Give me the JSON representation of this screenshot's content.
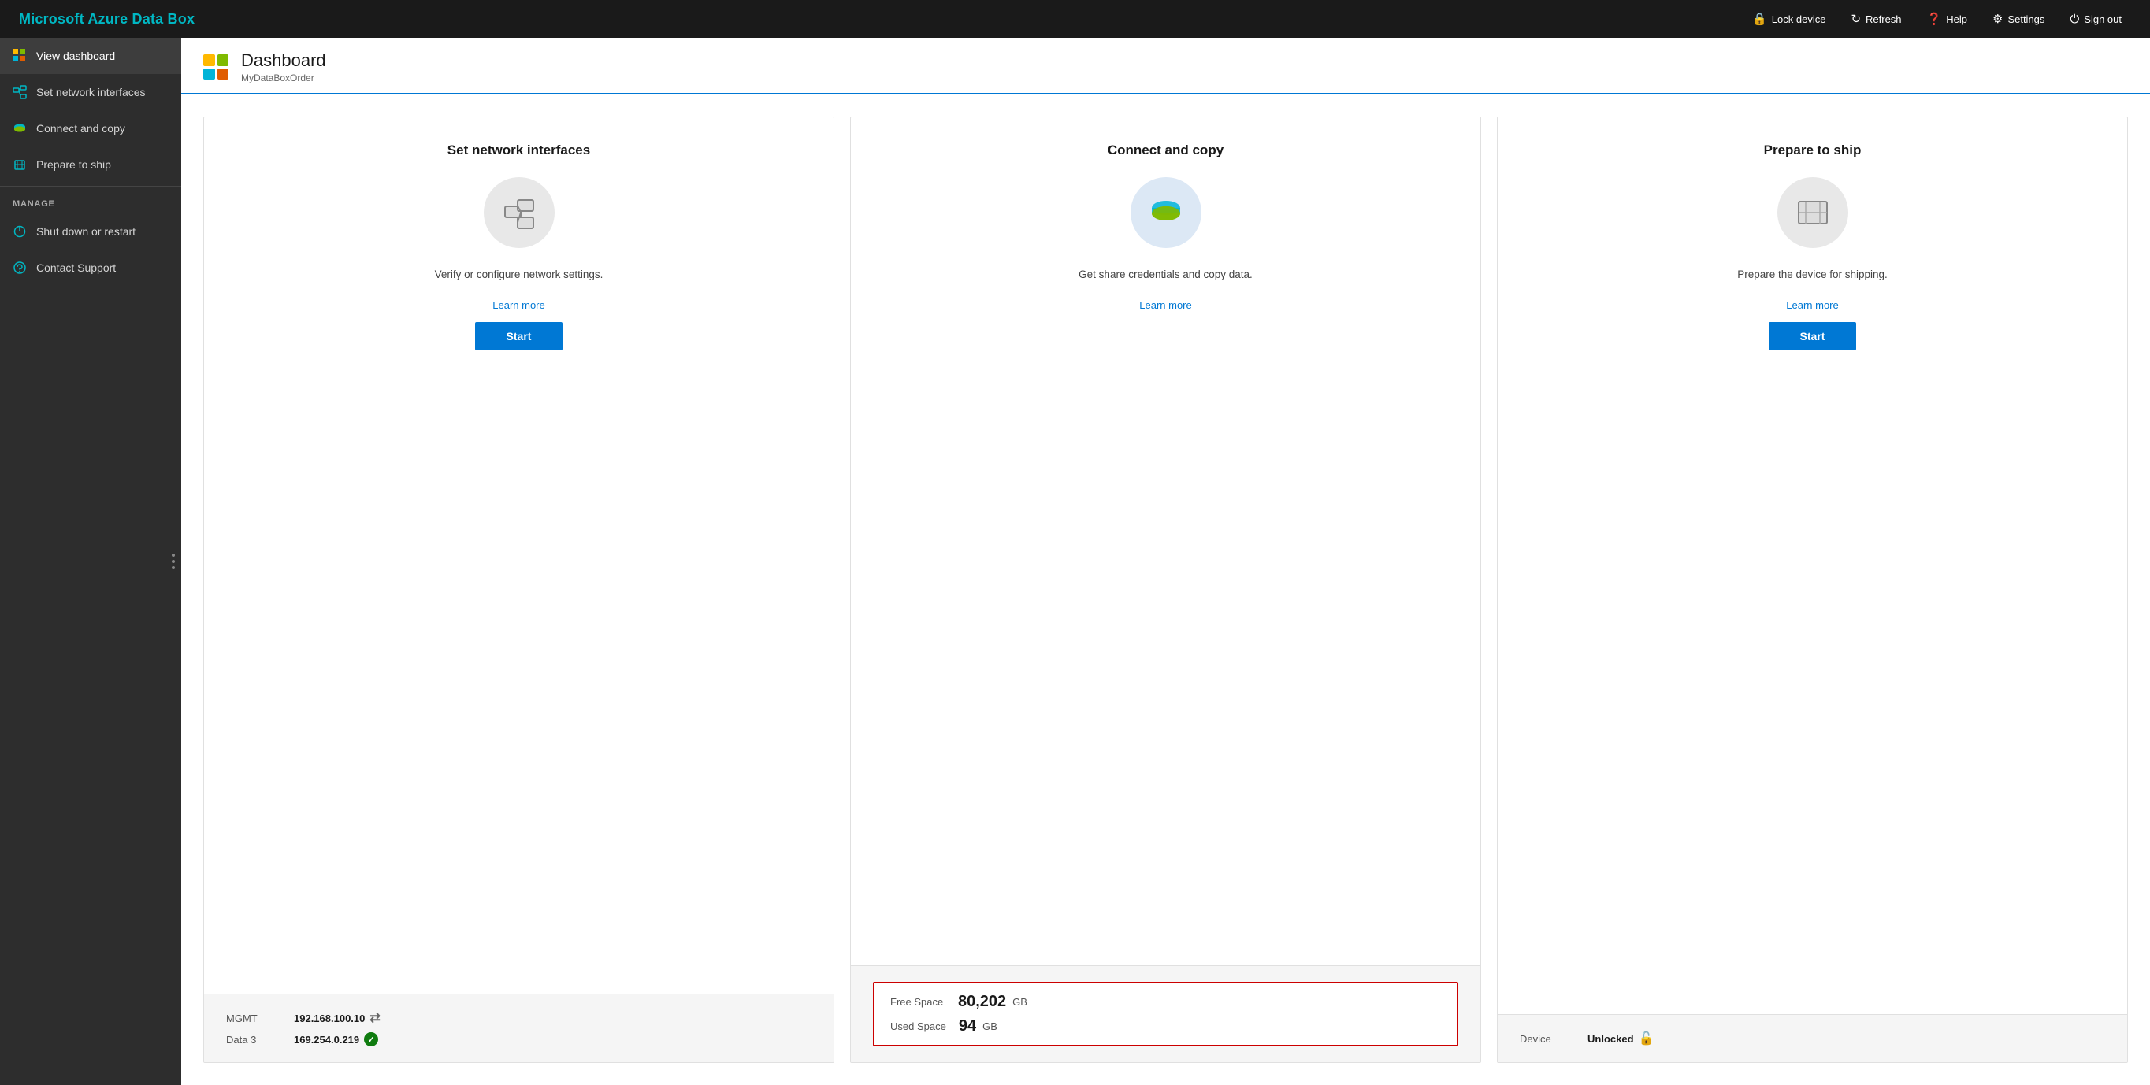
{
  "app": {
    "title": "Microsoft Azure Data Box"
  },
  "header": {
    "lock_label": "Lock device",
    "refresh_label": "Refresh",
    "help_label": "Help",
    "settings_label": "Settings",
    "signout_label": "Sign out"
  },
  "sidebar": {
    "nav_items": [
      {
        "id": "view-dashboard",
        "label": "View dashboard",
        "active": true
      },
      {
        "id": "set-network-interfaces",
        "label": "Set network interfaces",
        "active": false
      },
      {
        "id": "connect-and-copy",
        "label": "Connect and copy",
        "active": false
      },
      {
        "id": "prepare-to-ship",
        "label": "Prepare to ship",
        "active": false
      }
    ],
    "manage_label": "MANAGE",
    "manage_items": [
      {
        "id": "shut-down-or-restart",
        "label": "Shut down or restart"
      },
      {
        "id": "contact-support",
        "label": "Contact Support"
      }
    ]
  },
  "page": {
    "title": "Dashboard",
    "subtitle": "MyDataBoxOrder"
  },
  "cards": [
    {
      "id": "set-network-interfaces",
      "title": "Set network interfaces",
      "description": "Verify or configure network settings.",
      "learn_more_label": "Learn more",
      "start_label": "Start",
      "info": [
        {
          "label": "MGMT",
          "value": "192.168.100.10",
          "status": "arrow"
        },
        {
          "label": "Data 3",
          "value": "169.254.0.219",
          "status": "green"
        }
      ]
    },
    {
      "id": "connect-and-copy",
      "title": "Connect and copy",
      "description": "Get share credentials and copy data.",
      "learn_more_label": "Learn more",
      "start_label": null,
      "info": [
        {
          "label": "Free Space",
          "value": "80,202",
          "unit": "GB"
        },
        {
          "label": "Used Space",
          "value": "94",
          "unit": "GB"
        }
      ]
    },
    {
      "id": "prepare-to-ship",
      "title": "Prepare to ship",
      "description": "Prepare the device for shipping.",
      "learn_more_label": "Learn more",
      "start_label": "Start",
      "info": [
        {
          "label": "Device",
          "value": "Unlocked",
          "status": "unlock"
        }
      ]
    }
  ],
  "colors": {
    "brand_blue": "#0078d4",
    "sidebar_bg": "#2d2d2d",
    "header_bg": "#1a1a1a",
    "active_sidebar": "#3d3d3d",
    "icon_yellow": "#ffb900",
    "icon_orange": "#e05c00",
    "icon_green": "#7fba00",
    "icon_blue": "#00b4d8"
  }
}
